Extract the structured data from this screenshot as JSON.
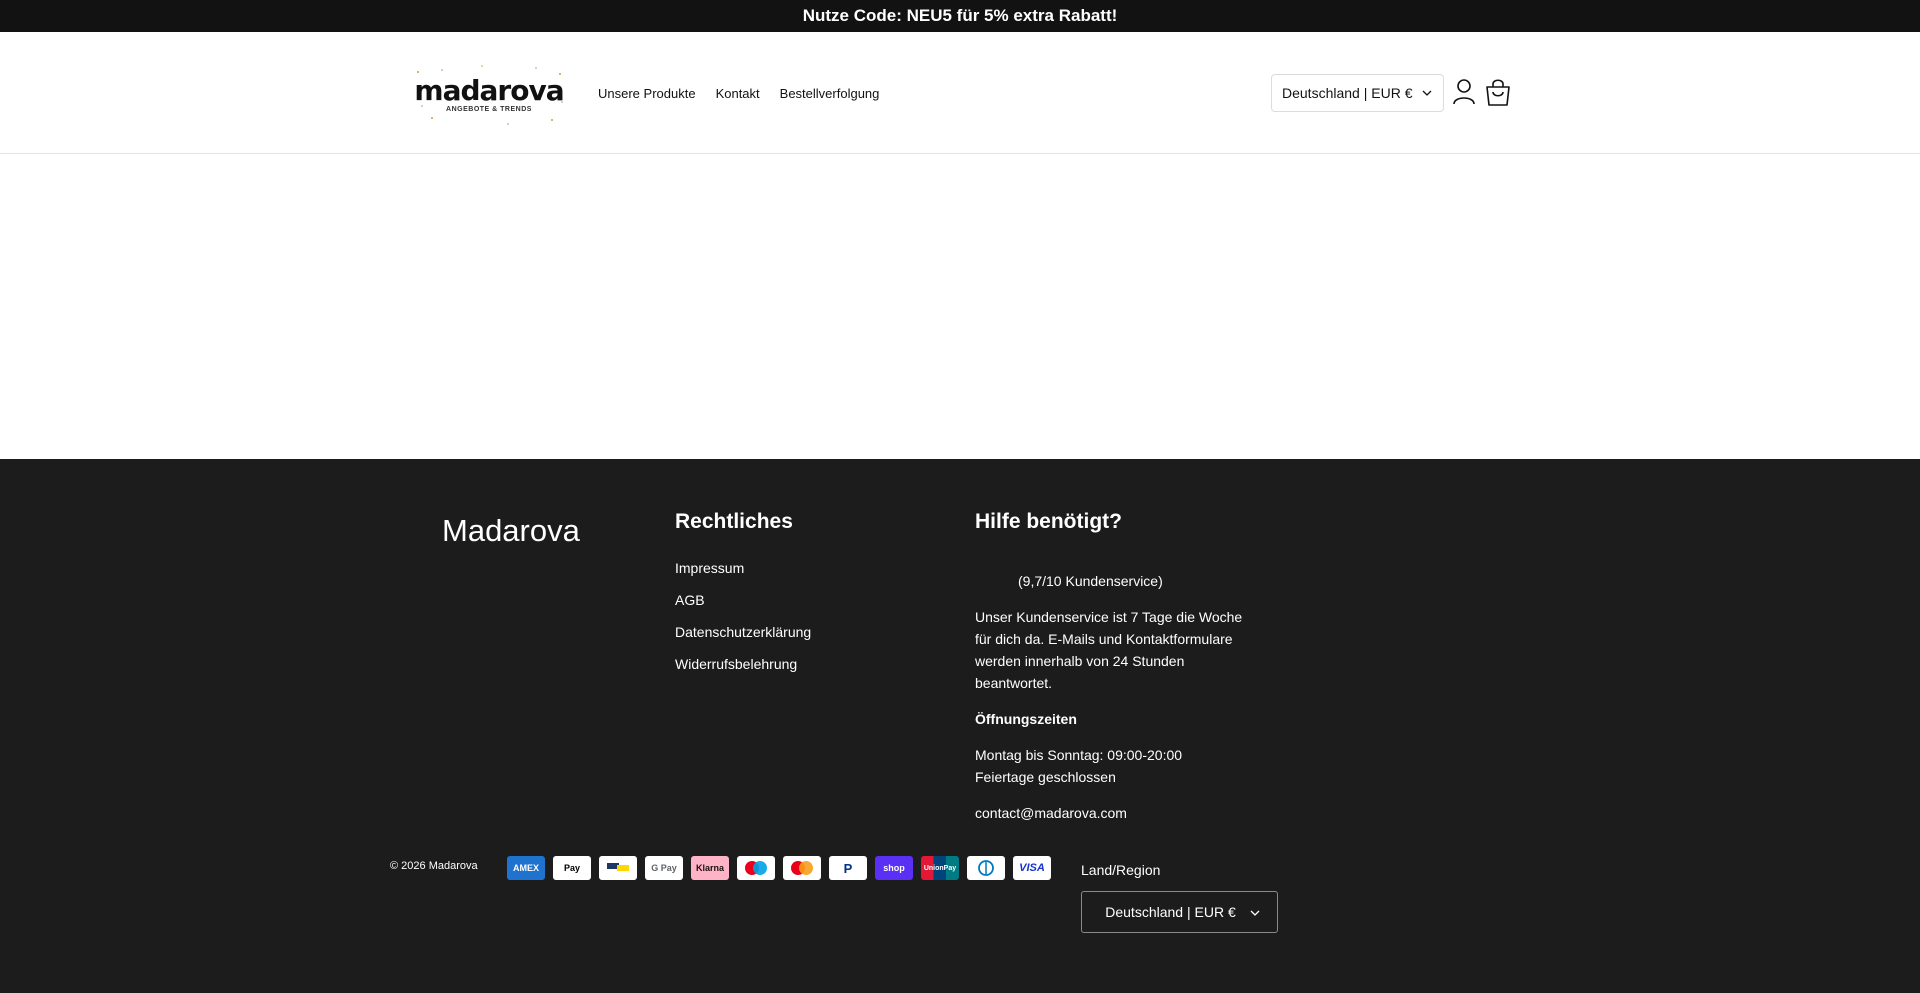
{
  "announcement": {
    "text": "Nutze Code: NEU5 für 5% extra Rabatt!"
  },
  "header": {
    "logo": {
      "word": "madarova",
      "tagline": "ANGEBOTE & TRENDS"
    },
    "nav": [
      "Unsere Produkte",
      "Kontakt",
      "Bestellverfolgung"
    ],
    "country_selector": "Deutschland | EUR €",
    "icons": [
      "account-icon",
      "cart-icon"
    ]
  },
  "footer": {
    "brand": "Madarova",
    "legal": {
      "title": "Rechtliches",
      "links": [
        "Impressum",
        "AGB",
        "Datenschutzerklärung",
        "Widerrufsbelehrung"
      ]
    },
    "help": {
      "title": "Hilfe benötigt?",
      "rating": "(9,7/10 Kundenservice)",
      "description": "Unser Kundenservice ist 7 Tage die Woche für dich da. E-Mails und Kontaktformulare werden innerhalb von 24 Stunden beantwortet.",
      "hours_title": "Öffnungszeiten",
      "hours_line1": "Montag bis Sonntag: 09:00-20:00",
      "hours_line2": "Feiertage geschlossen",
      "email": "contact@madarova.com"
    },
    "copyright": "© 2026 Madarova",
    "payment_methods": [
      "American Express",
      "Apple Pay",
      "Bancontact",
      "Google Pay",
      "Klarna",
      "Maestro",
      "Mastercard",
      "PayPal",
      "Shop Pay",
      "UnionPay",
      "Diners Club",
      "Visa"
    ],
    "region_label": "Land/Region",
    "region_selector": "Deutschland | EUR €"
  },
  "colors": {
    "announcement_bg": "#121212",
    "footer_bg": "#1c1c1c",
    "text": "#121212"
  }
}
